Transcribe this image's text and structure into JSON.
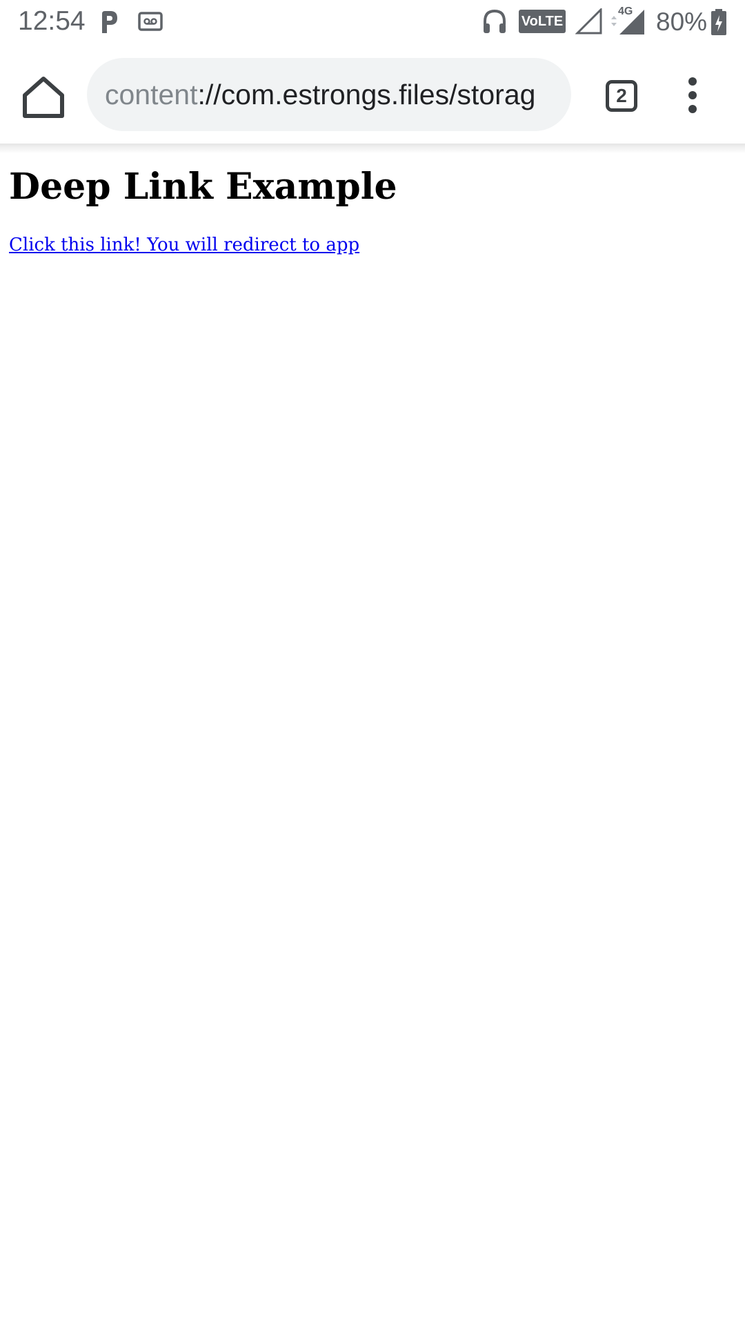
{
  "status_bar": {
    "time": "12:54",
    "battery_percent": "80%",
    "network_label": "4G",
    "volte_label": "VoLTE",
    "icons": [
      "parking-icon",
      "voicemail-icon",
      "headphones-icon",
      "volte-icon",
      "signal-empty-icon",
      "signal-4g-icon",
      "battery-charging-icon"
    ]
  },
  "toolbar": {
    "url_scheme": "content",
    "url_rest": "://com.estrongs.files/storag",
    "tab_count": "2",
    "icons": [
      "home-icon",
      "more-vert-icon"
    ]
  },
  "page": {
    "heading": "Deep Link Example",
    "link_text": "Click this link! You will redirect to app"
  },
  "colors": {
    "link": "#0000ee",
    "omnibox_bg": "#f1f3f4",
    "icon_gray": "#3c4043"
  }
}
